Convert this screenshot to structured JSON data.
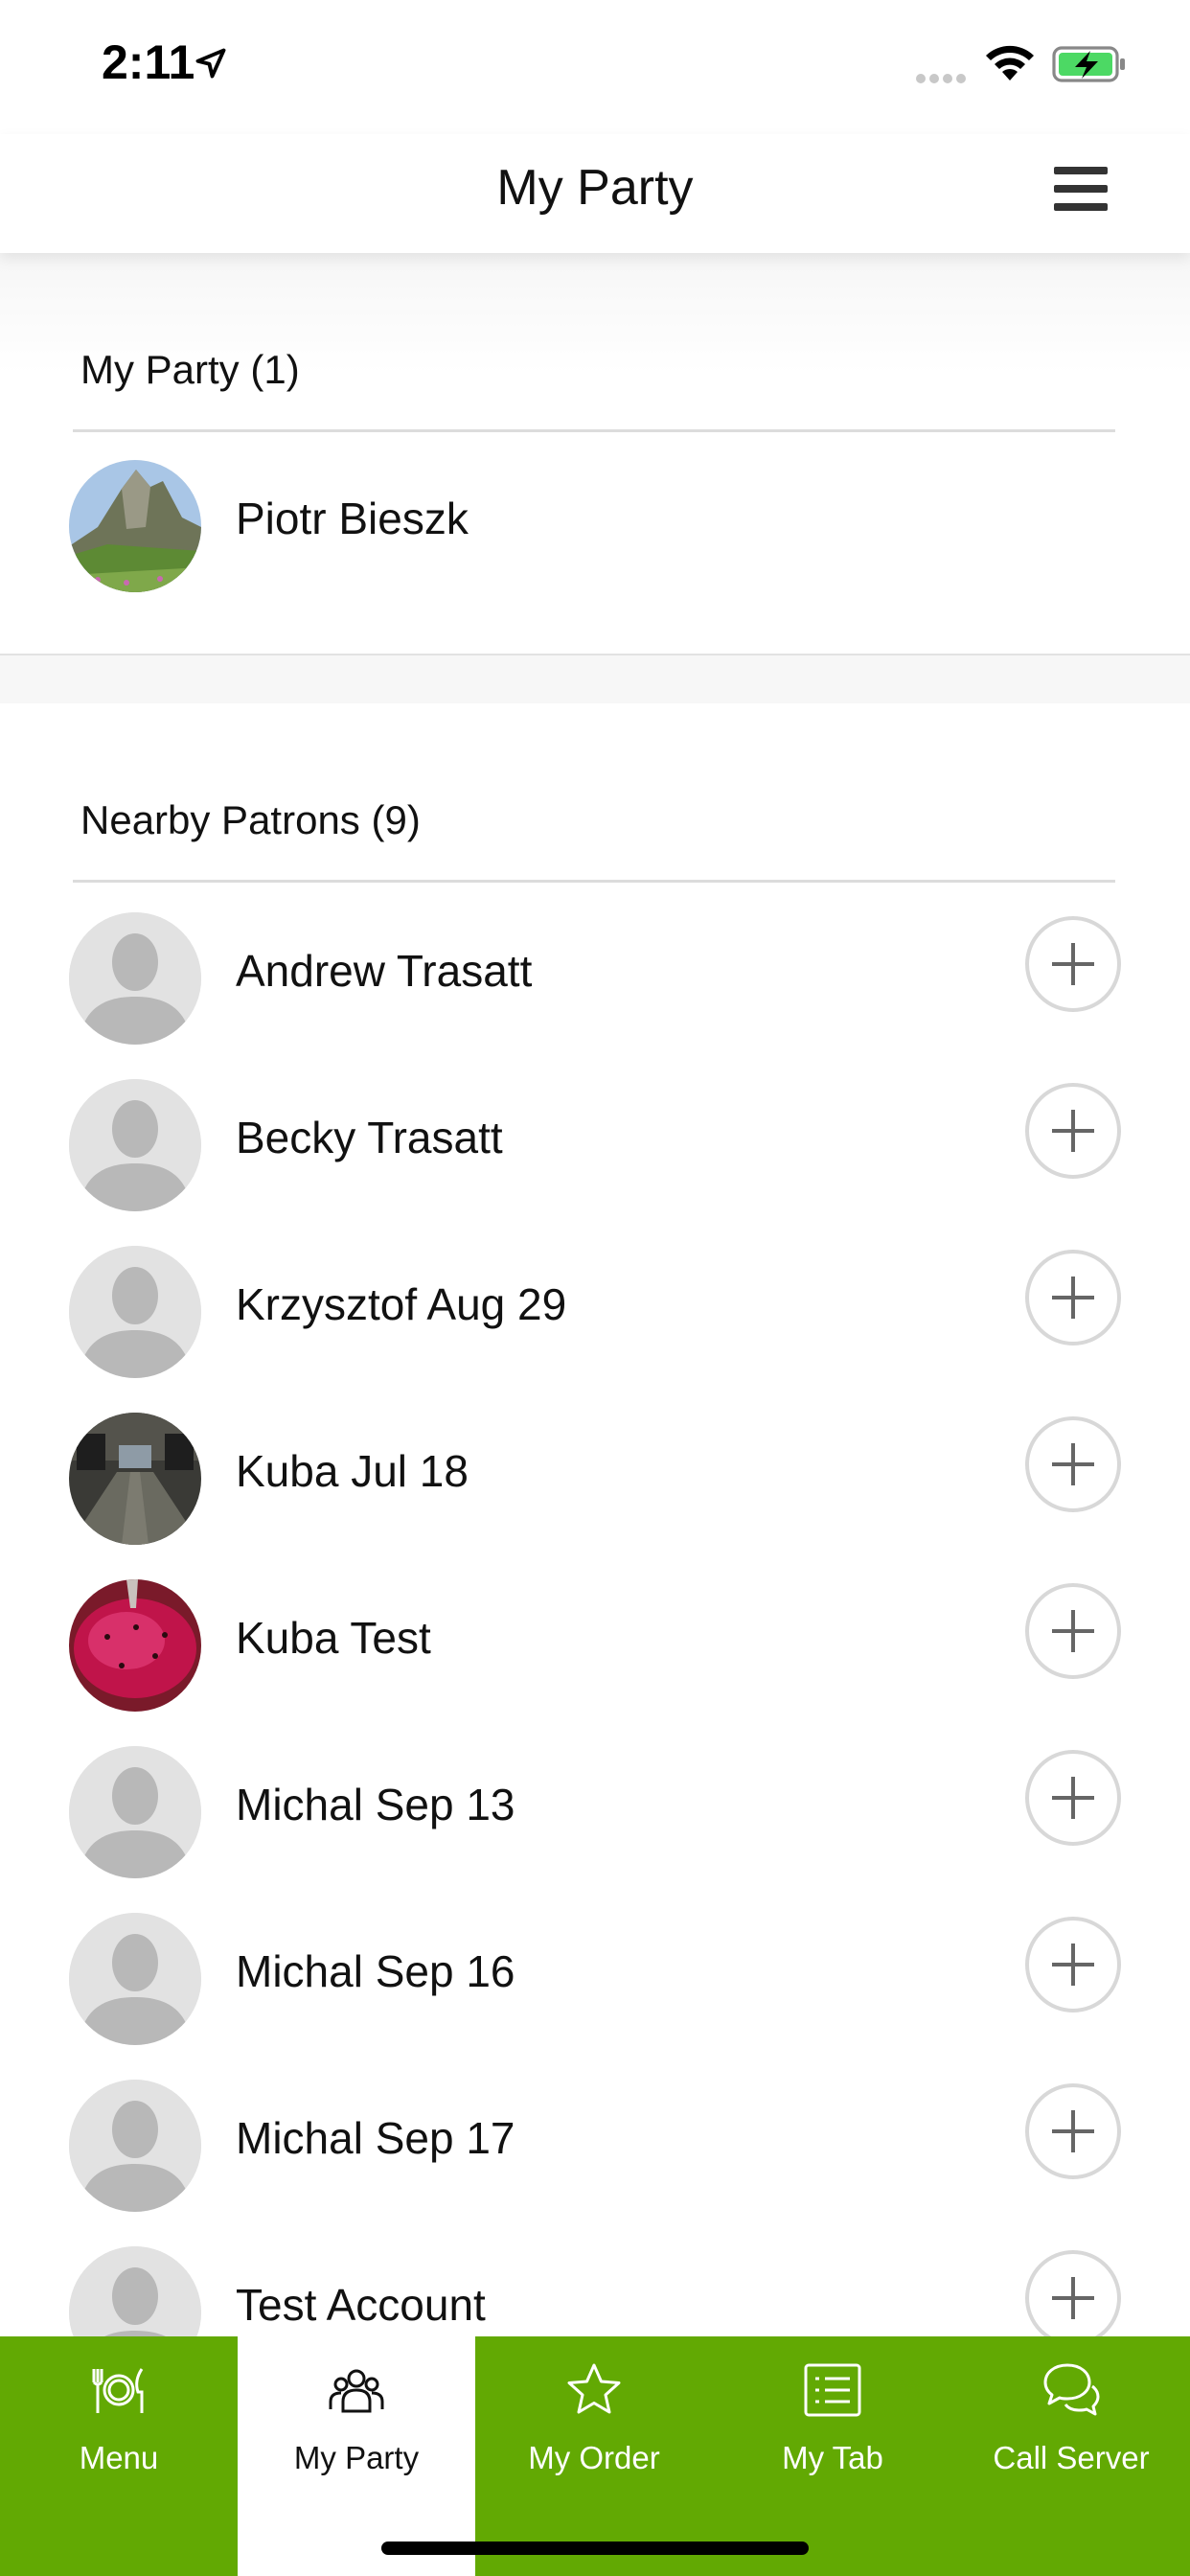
{
  "status_bar": {
    "time": "2:11"
  },
  "navbar": {
    "title": "My Party",
    "menu_icon": "hamburger-icon"
  },
  "my_party": {
    "header": "My Party (1)",
    "members": [
      {
        "name": "Piotr Bieszk",
        "avatar": "photo-mountain"
      }
    ]
  },
  "nearby": {
    "header": "Nearby Patrons (9)",
    "patrons": [
      {
        "name": "Andrew Trasatt",
        "avatar": "placeholder"
      },
      {
        "name": "Becky Trasatt",
        "avatar": "placeholder"
      },
      {
        "name": "Krzysztof Aug 29",
        "avatar": "placeholder"
      },
      {
        "name": "Kuba Jul 18",
        "avatar": "photo-hallway"
      },
      {
        "name": "Kuba Test",
        "avatar": "photo-red-fruit"
      },
      {
        "name": "Michal Sep 13",
        "avatar": "placeholder"
      },
      {
        "name": "Michal Sep 16",
        "avatar": "placeholder"
      },
      {
        "name": "Michal Sep 17",
        "avatar": "placeholder"
      },
      {
        "name": "Test Account",
        "avatar": "placeholder"
      }
    ]
  },
  "tabbar": {
    "tabs": [
      {
        "label": "Menu",
        "icon": "utensils-icon",
        "active": false
      },
      {
        "label": "My Party",
        "icon": "group-icon",
        "active": true
      },
      {
        "label": "My Order",
        "icon": "star-icon",
        "active": false
      },
      {
        "label": "My Tab",
        "icon": "list-icon",
        "active": false
      },
      {
        "label": "Call Server",
        "icon": "chat-bubbles-icon",
        "active": false
      }
    ]
  },
  "colors": {
    "accent": "#62a903",
    "divider": "#dcdcdc"
  }
}
